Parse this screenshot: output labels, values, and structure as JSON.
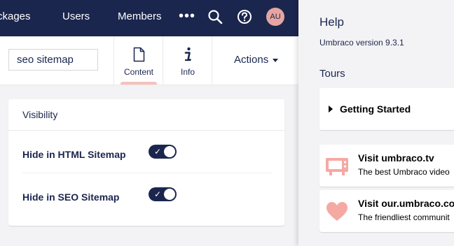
{
  "topbar": {
    "nav": [
      "ckages",
      "Users",
      "Members"
    ],
    "more_label": "•••",
    "avatar_initials": "AU",
    "icons": {
      "search": "search-icon",
      "help": "help-icon"
    }
  },
  "editor": {
    "name_value": "seo sitemap",
    "tabs": [
      {
        "label": "Content",
        "icon": "document-icon",
        "active": true
      },
      {
        "label": "Info",
        "icon": "info-icon",
        "active": false
      }
    ],
    "actions_label": "Actions"
  },
  "visibility": {
    "title": "Visibility",
    "properties": [
      {
        "label": "Hide in HTML Sitemap",
        "enabled": true
      },
      {
        "label": "Hide in SEO Sitemap",
        "enabled": true
      }
    ]
  },
  "help": {
    "title": "Help",
    "version": "Umbraco version 9.3.1",
    "tours_title": "Tours",
    "tours": [
      {
        "label": "Getting Started"
      }
    ],
    "links": [
      {
        "title": "Visit umbraco.tv",
        "desc": "The best Umbraco video",
        "icon": "tv-icon"
      },
      {
        "title": "Visit our.umbraco.co",
        "desc": "The friendliest communit",
        "icon": "heart-icon"
      }
    ]
  },
  "colors": {
    "header": "#1b264f",
    "accent": "#f5c1bc",
    "avatar": "#e6a5a0",
    "background": "#f3f3f5"
  }
}
